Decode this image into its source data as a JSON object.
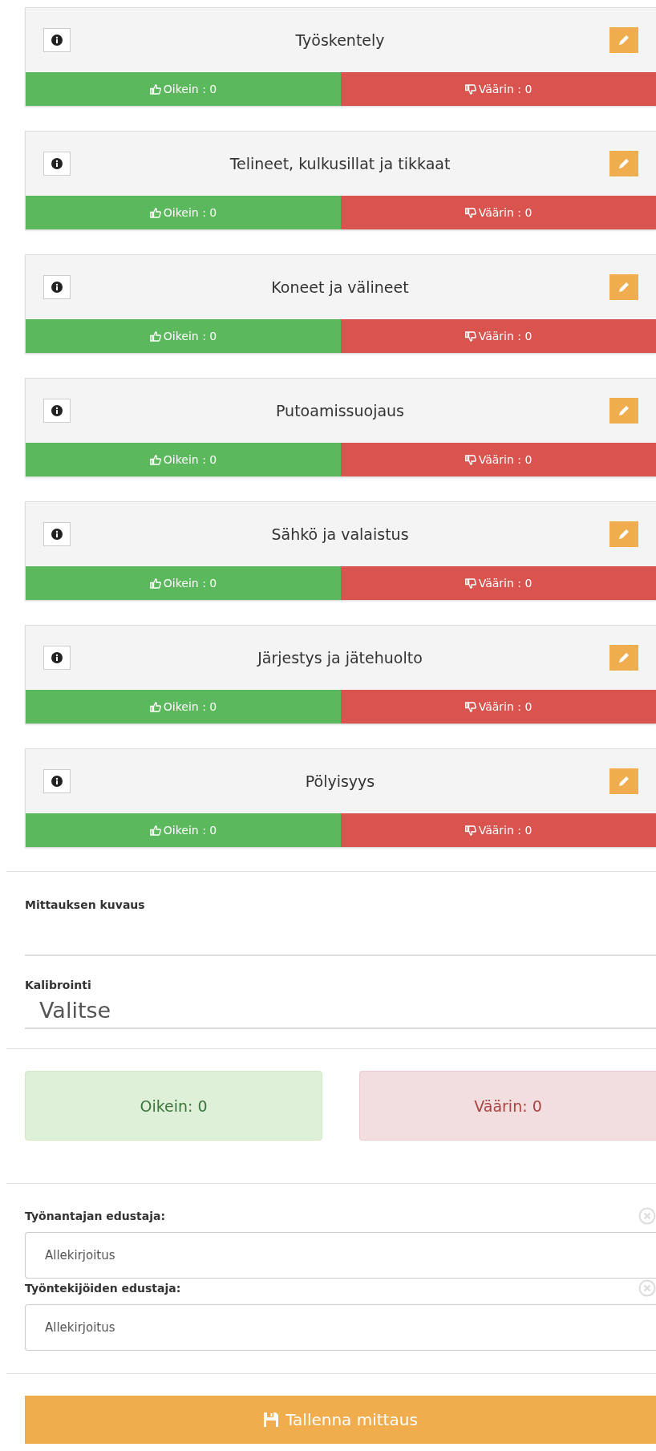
{
  "categories": [
    {
      "title": "Työskentely",
      "correct": "Oikein : 0",
      "wrong": "Väärin : 0"
    },
    {
      "title": "Telineet, kulkusillat ja tikkaat",
      "correct": "Oikein : 0",
      "wrong": "Väärin : 0"
    },
    {
      "title": "Koneet ja välineet",
      "correct": "Oikein : 0",
      "wrong": "Väärin : 0"
    },
    {
      "title": "Putoamissuojaus",
      "correct": "Oikein : 0",
      "wrong": "Väärin : 0"
    },
    {
      "title": "Sähkö ja valaistus",
      "correct": "Oikein : 0",
      "wrong": "Väärin : 0"
    },
    {
      "title": "Järjestys ja jätehuolto",
      "correct": "Oikein : 0",
      "wrong": "Väärin : 0"
    },
    {
      "title": "Pölyisyys",
      "correct": "Oikein : 0",
      "wrong": "Väärin : 0"
    }
  ],
  "description": {
    "label": "Mittauksen kuvaus"
  },
  "calibration": {
    "label": "Kalibrointi",
    "value": "Valitse"
  },
  "totals": {
    "correct": "Oikein: 0",
    "wrong": "Väärin: 0"
  },
  "signatures": [
    {
      "label": "Työnantajan edustaja:",
      "placeholder": "Allekirjoitus"
    },
    {
      "label": "Työntekijöiden edustaja:",
      "placeholder": "Allekirjoitus"
    }
  ],
  "save_button": "Tallenna mittaus"
}
